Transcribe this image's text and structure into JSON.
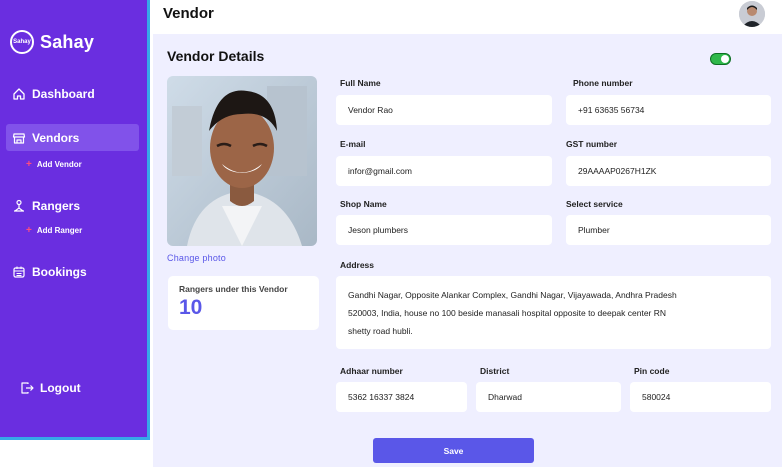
{
  "app": {
    "name": "Sahay",
    "logo_mark": "Sahay"
  },
  "sidebar": {
    "items": [
      {
        "label": "Dashboard",
        "icon": "home-icon"
      },
      {
        "label": "Vendors",
        "icon": "store-icon",
        "sub": "Add Vendor"
      },
      {
        "label": "Rangers",
        "icon": "ranger-icon",
        "sub": "Add Ranger"
      },
      {
        "label": "Bookings",
        "icon": "calendar-icon"
      }
    ],
    "logout": "Logout"
  },
  "header": {
    "title": "Vendor"
  },
  "details": {
    "title": "Vendor Details",
    "change_photo": "Change  photo",
    "rangers_label": "Rangers under this Vendor",
    "rangers_count": "10",
    "full_name": {
      "label": "Full Name",
      "value": "Vendor Rao"
    },
    "phone": {
      "label": "Phone number",
      "value": "+91 63635 56734"
    },
    "email": {
      "label": "E-mail",
      "value": "infor@gmail.com"
    },
    "gst": {
      "label": "GST number",
      "value": "29AAAAP0267H1ZK"
    },
    "shop": {
      "label": "Shop Name",
      "value": "Jeson plumbers"
    },
    "service": {
      "label": "Select service",
      "value": "Plumber"
    },
    "address": {
      "label": "Address",
      "line1": "Gandhi Nagar, Opposite Alankar Complex, Gandhi Nagar, Vijayawada, Andhra Pradesh",
      "line2": "520003, India, house no 100 beside manasali hospital opposite to deepak center RN",
      "line3": "shetty road hubli."
    },
    "adhaar": {
      "label": "Adhaar number",
      "value": "5362 16337 3824"
    },
    "district": {
      "label": "District",
      "value": "Dharwad"
    },
    "pincode": {
      "label": "Pin code",
      "value": "580024"
    },
    "save": "Save"
  },
  "colors": {
    "sidebar": "#6a2ee0",
    "accent": "#5a57e8",
    "toggle_on": "#2fb84a",
    "background": "#efefff"
  }
}
